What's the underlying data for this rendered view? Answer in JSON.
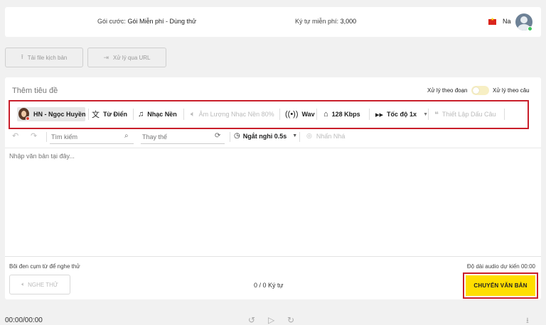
{
  "header": {
    "plan_label": "Gói cước:",
    "plan_value": "Gói Miễn phí - Dùng thử",
    "free_chars_label": "Ký tự miễn phí:",
    "free_chars_value": "3,000",
    "user_name": "Na"
  },
  "actions": {
    "upload_script": "Tải file kịch bản",
    "process_url": "Xử lý qua URL"
  },
  "editor": {
    "title_placeholder": "Thêm tiêu đề",
    "mode_left": "Xử lý theo đoạn",
    "mode_right": "Xử lý theo câu",
    "text_placeholder": "Nhập văn bản tại đây..."
  },
  "toolbar": {
    "voice": "HN - Ngọc Huyền",
    "dictionary": "Từ Điển",
    "background_music": "Nhạc Nền",
    "music_volume": "Âm Lượng Nhạc Nền 80%",
    "format": "Wav",
    "bitrate": "128 Kbps",
    "speed": "Tốc độ 1x",
    "punctuation": "Thiết Lập Dấu Câu"
  },
  "secondary": {
    "search_placeholder": "Tìm kiếm",
    "replace_placeholder": "Thay thế",
    "pause": "Ngắt nghỉ 0.5s",
    "emphasis": "Nhấn Nhá"
  },
  "footer": {
    "hint": "Bôi đen cụm từ để nghe thử",
    "duration": "Độ dài audio dự kiến 00:00",
    "listen": "NGHE THỬ",
    "counter": "0 / 0 Ký tự",
    "convert": "CHUYỂN VĂN BẢN"
  },
  "player": {
    "time": "00:00/00:00"
  },
  "colors": {
    "accent": "#ffde00",
    "highlight_border": "#c91e2a"
  }
}
